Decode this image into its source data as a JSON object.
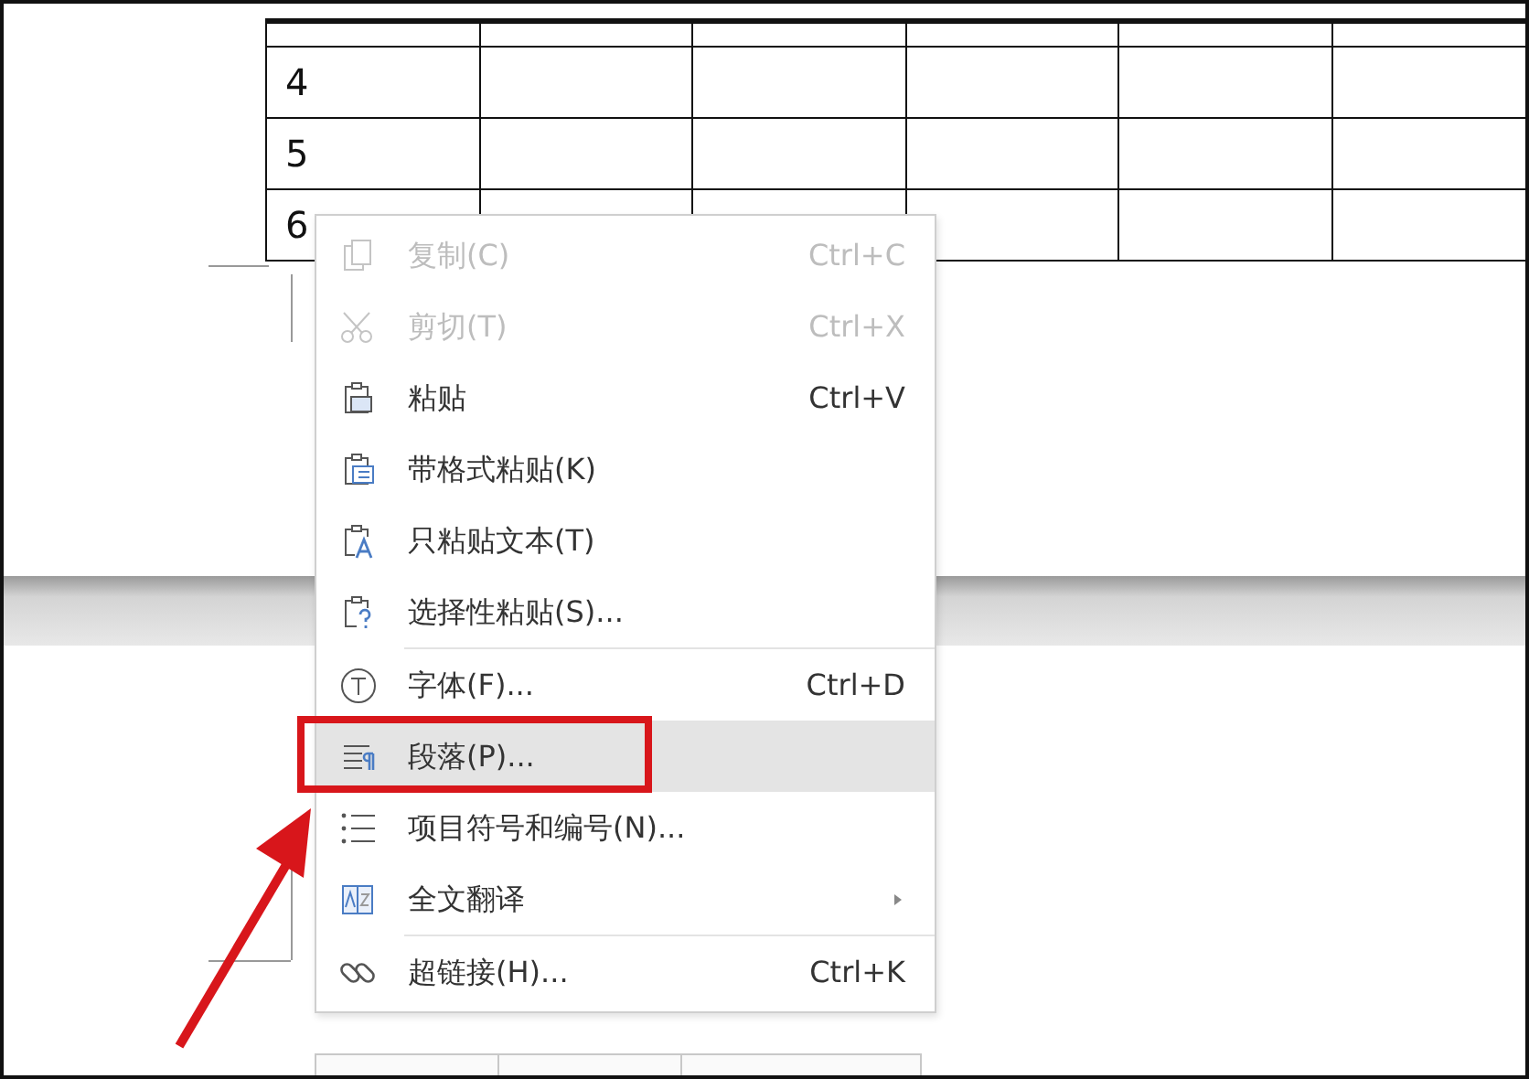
{
  "table": {
    "rows": [
      {
        "label": "4"
      },
      {
        "label": "5"
      },
      {
        "label": "6"
      }
    ]
  },
  "context_menu": {
    "items": [
      {
        "label": "复制(C)",
        "shortcut": "Ctrl+C",
        "disabled": true,
        "selected": false,
        "separator_after": false,
        "has_submenu": false
      },
      {
        "label": "剪切(T)",
        "shortcut": "Ctrl+X",
        "disabled": true,
        "selected": false,
        "separator_after": false,
        "has_submenu": false
      },
      {
        "label": "粘贴",
        "shortcut": "Ctrl+V",
        "disabled": false,
        "selected": false,
        "separator_after": false,
        "has_submenu": false
      },
      {
        "label": "带格式粘贴(K)",
        "disabled": false,
        "selected": false,
        "separator_after": false,
        "has_submenu": false
      },
      {
        "label": "只粘贴文本(T)",
        "disabled": false,
        "selected": false,
        "separator_after": false,
        "has_submenu": false
      },
      {
        "label": "选择性粘贴(S)...",
        "disabled": false,
        "selected": false,
        "separator_after": true,
        "has_submenu": false
      },
      {
        "label": "字体(F)...",
        "shortcut": "Ctrl+D",
        "disabled": false,
        "selected": false,
        "separator_after": false,
        "has_submenu": false
      },
      {
        "label": "段落(P)...",
        "disabled": false,
        "selected": true,
        "separator_after": false,
        "has_submenu": false
      },
      {
        "label": "项目符号和编号(N)...",
        "disabled": false,
        "selected": false,
        "separator_after": false,
        "has_submenu": false
      },
      {
        "label": "全文翻译",
        "disabled": false,
        "selected": false,
        "separator_after": true,
        "has_submenu": true
      },
      {
        "label": "超链接(H)...",
        "shortcut": "Ctrl+K",
        "disabled": false,
        "selected": false,
        "separator_after": false,
        "has_submenu": false
      }
    ]
  }
}
